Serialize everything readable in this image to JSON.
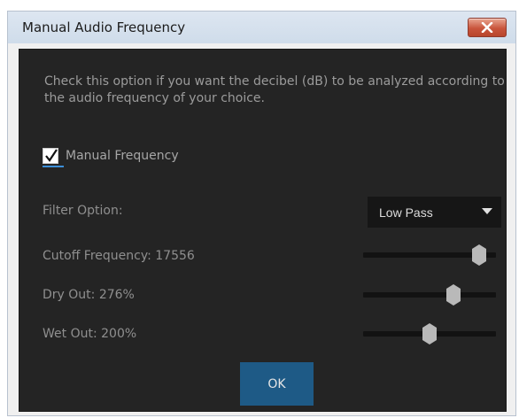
{
  "window": {
    "title": "Manual Audio Frequency",
    "close_icon": "close-x-icon"
  },
  "dialog": {
    "description": "Check this option if you want the decibel (dB) to be analyzed according to the audio frequency of your choice.",
    "manual_frequency": {
      "label": "Manual Frequency",
      "checked": true
    },
    "filter": {
      "label": "Filter Option:",
      "selected": "Low Pass",
      "arrow_icon": "dropdown-arrow-icon"
    },
    "sliders": [
      {
        "label": "Cutoff Frequency: 17556",
        "level": 0.87
      },
      {
        "label": "Dry Out: 276%",
        "level": 0.68
      },
      {
        "label": "Wet Out: 200%",
        "level": 0.5
      }
    ],
    "ok_label": "OK"
  },
  "colors": {
    "panel_bg": "#242424",
    "accent_button": "#1e5a86",
    "checkbox_underline": "#3d8fd8"
  }
}
